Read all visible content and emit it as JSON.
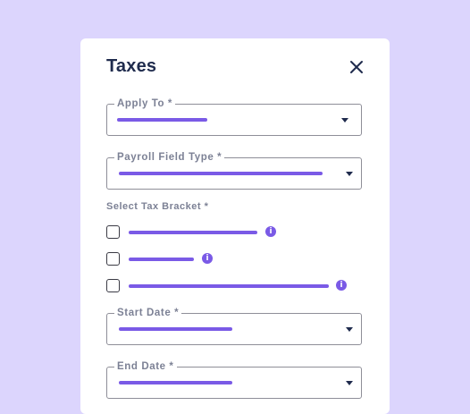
{
  "modal": {
    "title": "Taxes",
    "close_icon": "close-icon",
    "fields": {
      "apply_to": {
        "label": "Apply To *",
        "value_placeholder": "text-line"
      },
      "payroll_field_type": {
        "label": "Payroll Field Type *",
        "value_placeholder": "text-line"
      },
      "start_date": {
        "label": "Start Date *",
        "value_placeholder": "text-line"
      },
      "end_date": {
        "label": "End Date *",
        "value_placeholder": "text-line"
      }
    },
    "tax_bracket": {
      "label": "Select Tax Bracket *",
      "options": [
        {
          "checked": false,
          "info_icon": "i"
        },
        {
          "checked": false,
          "info_icon": "i"
        },
        {
          "checked": false,
          "info_icon": "i"
        }
      ]
    }
  },
  "colors": {
    "background": "#dcd5fd",
    "card": "#ffffff",
    "accent": "#7a5ae6",
    "title": "#1f2b4d",
    "label": "#7c8195",
    "border": "#8e8e98"
  }
}
